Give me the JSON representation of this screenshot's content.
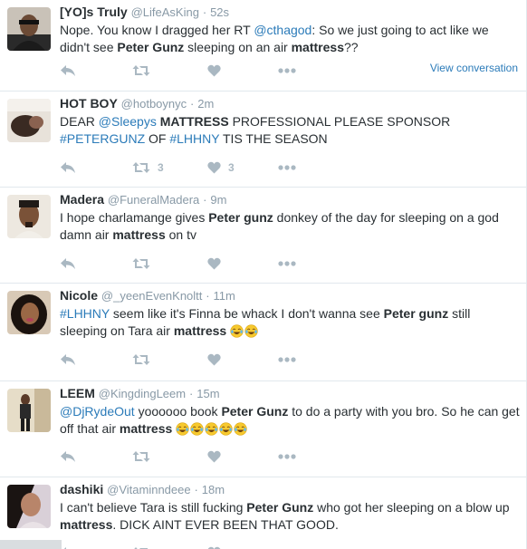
{
  "tweets": [
    {
      "name": "[YO]s Truly",
      "handle": "@LifeAsKing",
      "sep": "·",
      "time": "52s",
      "text": [
        {
          "t": "Nope. You know I dragged her  RT "
        },
        {
          "t": "@cthagod",
          "k": "link"
        },
        {
          "t": ": So we just going to act like we didn't see "
        },
        {
          "t": "Peter Gunz",
          "k": "b"
        },
        {
          "t": " sleeping on an air "
        },
        {
          "t": "mattress",
          "k": "b"
        },
        {
          "t": "??"
        }
      ],
      "reply_count": "",
      "retweet_count": "",
      "like_count": "",
      "view_conversation": "View conversation"
    },
    {
      "name": "HOT BOY",
      "handle": "@hotboynyc",
      "sep": "·",
      "time": "2m",
      "text": [
        {
          "t": "DEAR "
        },
        {
          "t": "@Sleepys",
          "k": "link"
        },
        {
          "t": " MATTRESS",
          "k": "b"
        },
        {
          "t": " PROFESSIONAL PLEASE SPONSOR "
        },
        {
          "t": "#PETERGUNZ",
          "k": "link"
        },
        {
          "t": " OF "
        },
        {
          "t": "#LHHNY",
          "k": "link"
        },
        {
          "t": " TIS THE SEASON"
        }
      ],
      "reply_count": "",
      "retweet_count": "3",
      "like_count": "3"
    },
    {
      "name": "Madera",
      "handle": "@FuneralMadera",
      "sep": "·",
      "time": "9m",
      "text": [
        {
          "t": "I hope charlamange gives "
        },
        {
          "t": "Peter gunz",
          "k": "b"
        },
        {
          "t": " donkey of the day for sleeping on a god damn air "
        },
        {
          "t": "mattress",
          "k": "b"
        },
        {
          "t": " on tv"
        }
      ],
      "reply_count": "",
      "retweet_count": "",
      "like_count": ""
    },
    {
      "name": "Nicole",
      "handle": "@_yeenEvenKnoltt",
      "sep": "·",
      "time": "11m",
      "text": [
        {
          "t": "#LHHNY",
          "k": "link"
        },
        {
          "t": " seem like it's Finna be whack I don't wanna see "
        },
        {
          "t": "Peter gunz",
          "k": "b"
        },
        {
          "t": " still sleeping on Tara air "
        },
        {
          "t": "mattress",
          "k": "b"
        },
        {
          "t": " "
        },
        {
          "e": 2
        }
      ],
      "reply_count": "",
      "retweet_count": "",
      "like_count": ""
    },
    {
      "name": "LEEM",
      "handle": "@KingdingLeem",
      "sep": "·",
      "time": "15m",
      "text": [
        {
          "t": "@DjRydeOut",
          "k": "link"
        },
        {
          "t": " yoooooo book "
        },
        {
          "t": "Peter Gunz",
          "k": "b"
        },
        {
          "t": " to do a party with you bro.  So he can get off that air "
        },
        {
          "t": "mattress",
          "k": "b"
        },
        {
          "t": " "
        },
        {
          "e": 5
        }
      ],
      "reply_count": "",
      "retweet_count": "",
      "like_count": ""
    },
    {
      "name": "dashiki",
      "handle": "@Vitaminndeee",
      "sep": "·",
      "time": "18m",
      "text": [
        {
          "t": "I can't believe Tara is still fucking "
        },
        {
          "t": "Peter Gunz",
          "k": "b"
        },
        {
          "t": " who got her sleeping on a blow up "
        },
        {
          "t": "mattress",
          "k": "b"
        },
        {
          "t": ". DICK AINT EVER BEEN THAT GOOD."
        }
      ],
      "reply_count": "",
      "retweet_count": "",
      "like_count": ""
    }
  ],
  "colors": {
    "name": "#292f33",
    "meta": "#8899a6",
    "link": "#2b7bb9",
    "action": "#aab8c2",
    "divider": "#e1e8ed"
  },
  "icons": {
    "reply": "reply-icon",
    "retweet": "retweet-icon",
    "like": "heart-icon",
    "more": "more-icon",
    "emoji": "face-with-tears-of-joy-icon"
  }
}
